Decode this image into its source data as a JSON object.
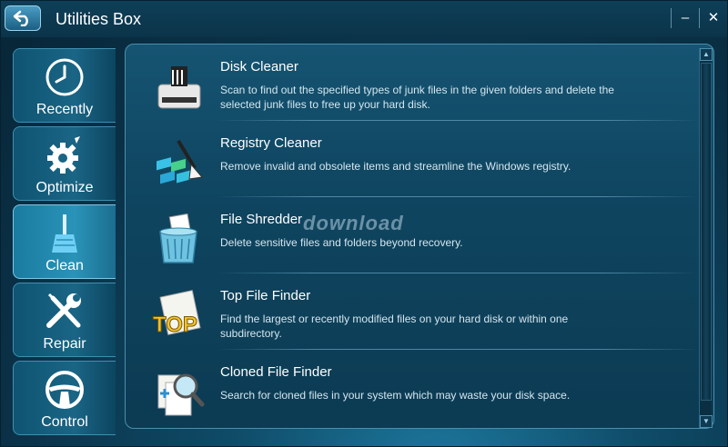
{
  "window": {
    "title": "Utilities Box",
    "minimize_label": "–",
    "close_label": "✕"
  },
  "sidebar": {
    "items": [
      {
        "label": "Recently",
        "icon": "clock-icon"
      },
      {
        "label": "Optimize",
        "icon": "gear-icon"
      },
      {
        "label": "Clean",
        "icon": "broom-icon",
        "active": true
      },
      {
        "label": "Repair",
        "icon": "wrench-screwdriver-icon"
      },
      {
        "label": "Control",
        "icon": "steering-wheel-icon"
      }
    ]
  },
  "tools": [
    {
      "title": "Disk Cleaner",
      "description": "Scan to find out the specified types of junk files in the given folders and delete the selected junk files to free up your hard disk.",
      "icon": "disk-cleaner-icon"
    },
    {
      "title": "Registry Cleaner",
      "description": "Remove invalid and obsolete items and streamline the Windows registry.",
      "icon": "registry-cleaner-icon"
    },
    {
      "title": "File Shredder",
      "description": "Delete sensitive files and folders beyond recovery.",
      "icon": "file-shredder-icon"
    },
    {
      "title": "Top File Finder",
      "description": "Find the largest or recently modified files on your hard disk or within one subdirectory.",
      "icon": "top-file-finder-icon",
      "icon_text": "TOP"
    },
    {
      "title": "Cloned File Finder",
      "description": "Search for cloned files in your system which may waste your disk space.",
      "icon": "cloned-file-finder-icon"
    }
  ],
  "watermark": "download"
}
